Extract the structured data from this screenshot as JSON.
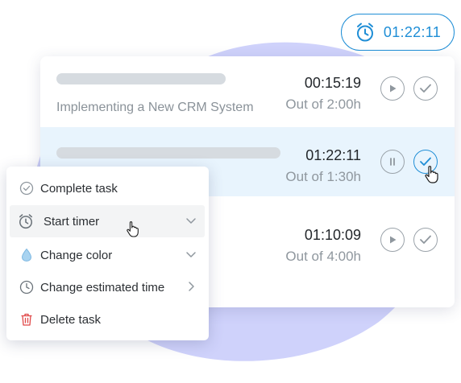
{
  "timer_pill": {
    "time": "01:22:11",
    "icon": "alarm-clock-icon"
  },
  "tasks": [
    {
      "name": "Implementing a New CRM System",
      "time": "00:15:19",
      "estimate": "Out of 2:00h",
      "state": "paused"
    },
    {
      "name": "",
      "time": "01:22:11",
      "estimate": "Out of 1:30h",
      "state": "running"
    },
    {
      "name": "",
      "time": "01:10:09",
      "estimate": "Out of 4:00h",
      "state": "paused"
    }
  ],
  "context_menu": {
    "items": [
      {
        "label": "Complete task",
        "icon": "check-circle-icon"
      },
      {
        "label": "Start timer",
        "icon": "alarm-clock-icon"
      },
      {
        "label": "Change color",
        "icon": "droplet-icon"
      },
      {
        "label": "Change estimated time",
        "icon": "clock-icon"
      },
      {
        "label": "Delete task",
        "icon": "trash-icon"
      }
    ]
  },
  "colors": {
    "accent": "#1f8ed6",
    "blob": "#cfd2fb",
    "active_row": "#e8f4fd",
    "delete": "#e04848"
  }
}
